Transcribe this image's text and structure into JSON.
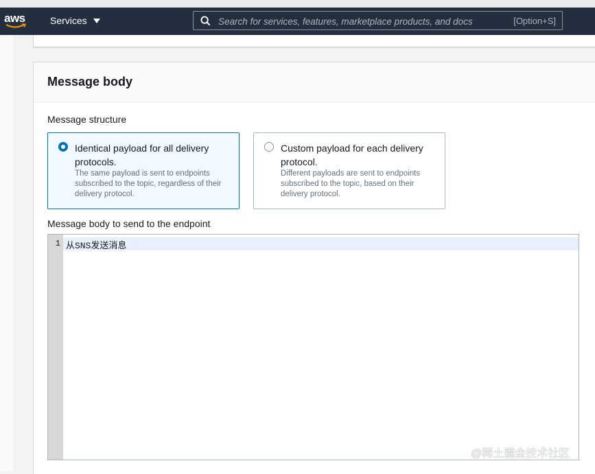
{
  "topnav": {
    "logo": "aws",
    "services_label": "Services",
    "search_placeholder": "Search for services, features, marketplace products, and docs",
    "search_shortcut": "[Option+S]"
  },
  "message_body": {
    "title": "Message body",
    "structure_label": "Message structure",
    "options": [
      {
        "title": "Identical payload for all delivery protocols.",
        "description": "The same payload is sent to endpoints subscribed to the topic, regardless of their delivery protocol.",
        "selected": true
      },
      {
        "title": "Custom payload for each delivery protocol.",
        "description": "Different payloads are sent to endpoints subscribed to the topic, based on their delivery protocol.",
        "selected": false
      }
    ],
    "body_label": "Message body to send to the endpoint",
    "editor": {
      "line_number": "1",
      "content": "从SNS发送消息"
    }
  },
  "watermark": "@稀土掘金技术社区",
  "colors": {
    "nav_bg": "#232f3e",
    "accent": "#0073bb",
    "selected_tile_bg": "#f1faff"
  }
}
